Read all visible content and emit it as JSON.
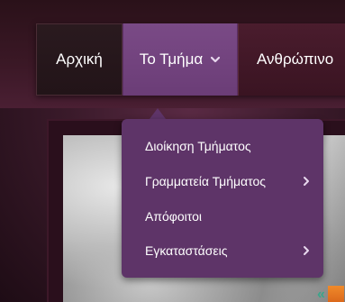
{
  "nav": {
    "items": [
      {
        "label": "Αρχική"
      },
      {
        "label": "Το Τμήμα"
      },
      {
        "label": "Ανθρώπινο"
      }
    ]
  },
  "dropdown": {
    "items": [
      {
        "label": "Διοίκηση Τμήματος",
        "has_submenu": false
      },
      {
        "label": "Γραμματεία Τμήματος",
        "has_submenu": true
      },
      {
        "label": "Απόφοιτοι",
        "has_submenu": false
      },
      {
        "label": "Εγκαταστάσεις",
        "has_submenu": true
      }
    ]
  },
  "corner": {
    "arrows": "«"
  },
  "colors": {
    "nav_active": "#6b3d77",
    "dropdown_bg": "#5e3468",
    "background": "#3a1a2a",
    "corner_arrows": "#3aa58a",
    "corner_tile": "#e0701f"
  }
}
